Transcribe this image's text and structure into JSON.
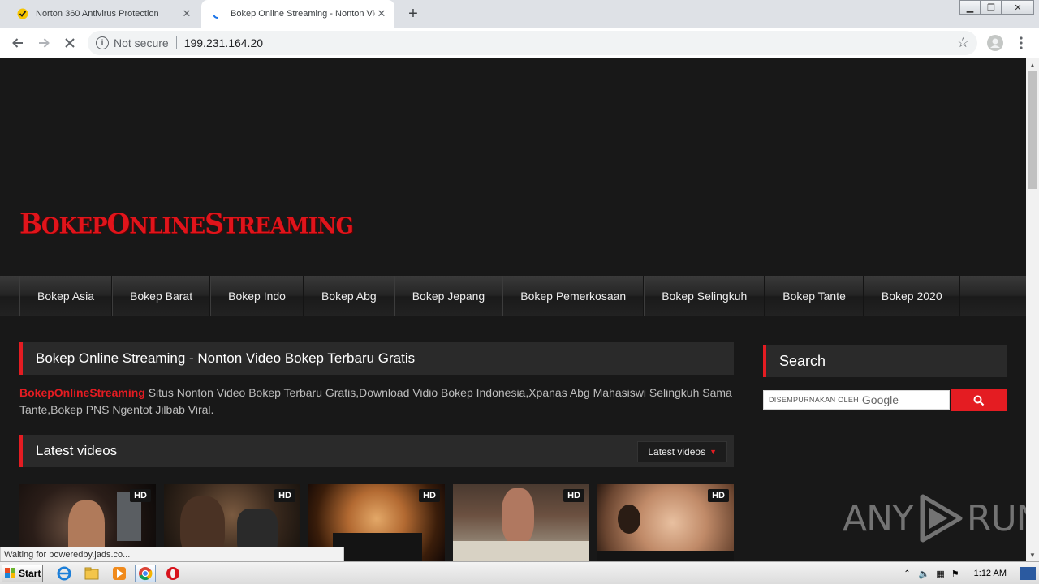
{
  "browser": {
    "tabs": [
      {
        "title": "Norton 360 Antivirus Protection",
        "active": false
      },
      {
        "title": "Bokep Online Streaming - Nonton Vid",
        "active": true
      }
    ],
    "new_tab_symbol": "+",
    "security_label": "Not secure",
    "url": "199.231.164.20",
    "icons": {
      "back": "back-arrow-icon",
      "forward": "forward-arrow-icon",
      "reload": "stop-loading-icon",
      "bookmark": "star-icon",
      "profile": "profile-avatar-icon",
      "menu": "kebab-menu-icon"
    }
  },
  "site": {
    "logo_parts": [
      {
        "cap": "B",
        "rest": "OKEP"
      },
      {
        "cap": "O",
        "rest": "NLINE"
      },
      {
        "cap": "S",
        "rest": "TREAMING"
      }
    ],
    "nav": [
      "Bokep Asia",
      "Bokep Barat",
      "Bokep Indo",
      "Bokep Abg",
      "Bokep Jepang",
      "Bokep Pemerkosaan",
      "Bokep Selingkuh",
      "Bokep Tante",
      "Bokep 2020"
    ],
    "main_title": "Bokep Online Streaming - Nonton Video Bokep Terbaru Gratis",
    "description_brand": "BokepOnlineStreaming",
    "description_text": " Situs Nonton Video Bokep Terbaru Gratis,Download Vidio Bokep Indonesia,Xpanas Abg Mahasiswi Selingkuh Sama Tante,Bokep PNS Ngentot Jilbab Viral.",
    "latest_heading": "Latest videos",
    "sort_label": "Latest videos",
    "video_badges": [
      "HD",
      "HD",
      "HD",
      "HD",
      "HD"
    ],
    "sidebar": {
      "search_heading": "Search",
      "powered_by": "DISEMPURNAKAN OLEH",
      "google_word": "Google"
    },
    "accent_color": "#e41c22"
  },
  "status_bubble": "Waiting for poweredby.jads.co...",
  "watermark": {
    "left": "ANY",
    "right": "RUN"
  },
  "taskbar": {
    "start_label": "Start",
    "clock": "1:12 AM"
  }
}
